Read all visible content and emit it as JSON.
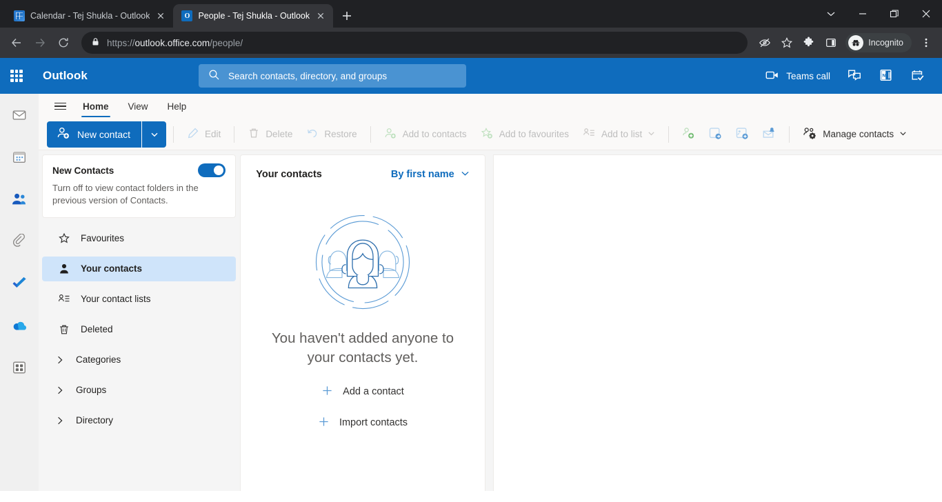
{
  "browser": {
    "tabs": [
      {
        "title": "Calendar - Tej Shukla - Outlook",
        "favicon": "calendar-favicon",
        "active": false
      },
      {
        "title": "People - Tej Shukla - Outlook",
        "favicon": "outlook-favicon",
        "active": true
      }
    ],
    "new_tab_label": "+",
    "window_controls": [
      "minimize-to-tray-chevron",
      "minimize",
      "restore",
      "close"
    ],
    "nav": {
      "back": "back-arrow",
      "forward": "forward-arrow",
      "reload": "reload-icon"
    },
    "omnibox": {
      "lock": "lock-icon",
      "url_prefix": "https://",
      "url_domain": "outlook.office.com",
      "url_path": "/people/",
      "full_url": "https://outlook.office.com/people/"
    },
    "omnibox_actions": [
      "tracking-protection-icon",
      "bookmark-star-icon"
    ],
    "toolbar_actions": [
      "extensions-puzzle-icon",
      "side-panel-icon"
    ],
    "profile_chip": {
      "label": "Incognito",
      "icon": "incognito-hat-icon"
    },
    "menu": "three-dot-menu-icon"
  },
  "owa": {
    "app_launcher": "waffle-grid-icon",
    "brand": "Outlook",
    "search": {
      "icon": "search-icon",
      "placeholder": "Search contacts, directory, and groups",
      "value": ""
    },
    "header_actions": [
      {
        "name": "teams-call",
        "icon": "video-camera-icon",
        "label": "Teams call"
      },
      {
        "name": "chat",
        "icon": "chat-bubbles-icon",
        "label": ""
      },
      {
        "name": "onenote-feed",
        "icon": "onenote-icon",
        "label": ""
      },
      {
        "name": "my-day",
        "icon": "calendar-check-icon",
        "label": ""
      }
    ]
  },
  "rail": {
    "items": [
      {
        "name": "mail",
        "icon": "mail-envelope-icon",
        "active": false
      },
      {
        "name": "calendar",
        "icon": "calendar-icon",
        "active": false
      },
      {
        "name": "people",
        "icon": "people-icon",
        "active": true
      },
      {
        "name": "files",
        "icon": "paperclip-icon",
        "active": false
      },
      {
        "name": "to-do",
        "icon": "checkmark-icon",
        "active": false
      },
      {
        "name": "onedrive",
        "icon": "cloud-icon",
        "active": false
      },
      {
        "name": "more-apps",
        "icon": "apps-grid-icon",
        "active": false
      }
    ]
  },
  "ribbon": {
    "hamburger": "hamburger-icon",
    "tabs": [
      {
        "label": "Home",
        "active": true
      },
      {
        "label": "View",
        "active": false
      },
      {
        "label": "Help",
        "active": false
      }
    ],
    "new_contact": {
      "label": "New contact",
      "icon": "person-add-icon",
      "caret": "chevron-down-icon"
    },
    "commands": [
      {
        "label": "Edit",
        "icon": "pencil-icon",
        "enabled": false
      },
      {
        "label": "Delete",
        "icon": "trash-icon",
        "enabled": false
      },
      {
        "label": "Restore",
        "icon": "restore-arrow-icon",
        "enabled": false
      },
      {
        "label": "Add to contacts",
        "icon": "person-add-green-icon",
        "enabled": false
      },
      {
        "label": "Add to favourites",
        "icon": "star-add-icon",
        "enabled": false
      },
      {
        "label": "Add to list",
        "icon": "list-add-icon",
        "enabled": false,
        "caret": "chevron-down-icon"
      }
    ],
    "icon_commands": [
      {
        "name": "add-contact-icon-button",
        "icon": "person-add-green-icon"
      },
      {
        "name": "share-contact-icon-button",
        "icon": "contact-share-icon"
      },
      {
        "name": "new-contact-card-icon-button",
        "icon": "contact-card-add-icon"
      },
      {
        "name": "email-contact-icon-button",
        "icon": "mail-person-icon"
      }
    ],
    "manage_contacts": {
      "label": "Manage contacts",
      "icon": "people-gear-icon",
      "caret": "chevron-down-icon"
    }
  },
  "sidebar": {
    "new_contacts_card": {
      "title": "New Contacts",
      "description": "Turn off to view contact folders in the previous version of Contacts.",
      "toggle_on": true,
      "accent": "#0f6cbd"
    },
    "items": [
      {
        "label": "Favourites",
        "icon": "star-icon",
        "selected": false,
        "group": false
      },
      {
        "label": "Your contacts",
        "icon": "person-icon",
        "selected": true,
        "group": false
      },
      {
        "label": "Your contact lists",
        "icon": "contact-list-icon",
        "selected": false,
        "group": false
      },
      {
        "label": "Deleted",
        "icon": "trash-icon",
        "selected": false,
        "group": false
      },
      {
        "label": "Categories",
        "icon": "chevron-right-icon",
        "selected": false,
        "group": true
      },
      {
        "label": "Groups",
        "icon": "chevron-right-icon",
        "selected": false,
        "group": true
      },
      {
        "label": "Directory",
        "icon": "chevron-right-icon",
        "selected": false,
        "group": true
      }
    ]
  },
  "list_pane": {
    "title": "Your contacts",
    "sort": {
      "label": "By first name",
      "caret": "chevron-down-icon"
    },
    "empty_state": {
      "illustration": "people-circle-illustration",
      "message": "You haven't added anyone to your contacts yet.",
      "actions": [
        {
          "label": "Add a contact",
          "icon": "plus-icon"
        },
        {
          "label": "Import contacts",
          "icon": "plus-icon"
        }
      ]
    }
  },
  "colors": {
    "brand_blue": "#0f6cbd",
    "selected_blue": "#cfe4fa",
    "chrome_dark": "#202124",
    "chrome_toolbar": "#35363a",
    "text_primary": "#201f1e",
    "text_secondary": "#605e5c",
    "disabled": "#bdbdbd"
  }
}
